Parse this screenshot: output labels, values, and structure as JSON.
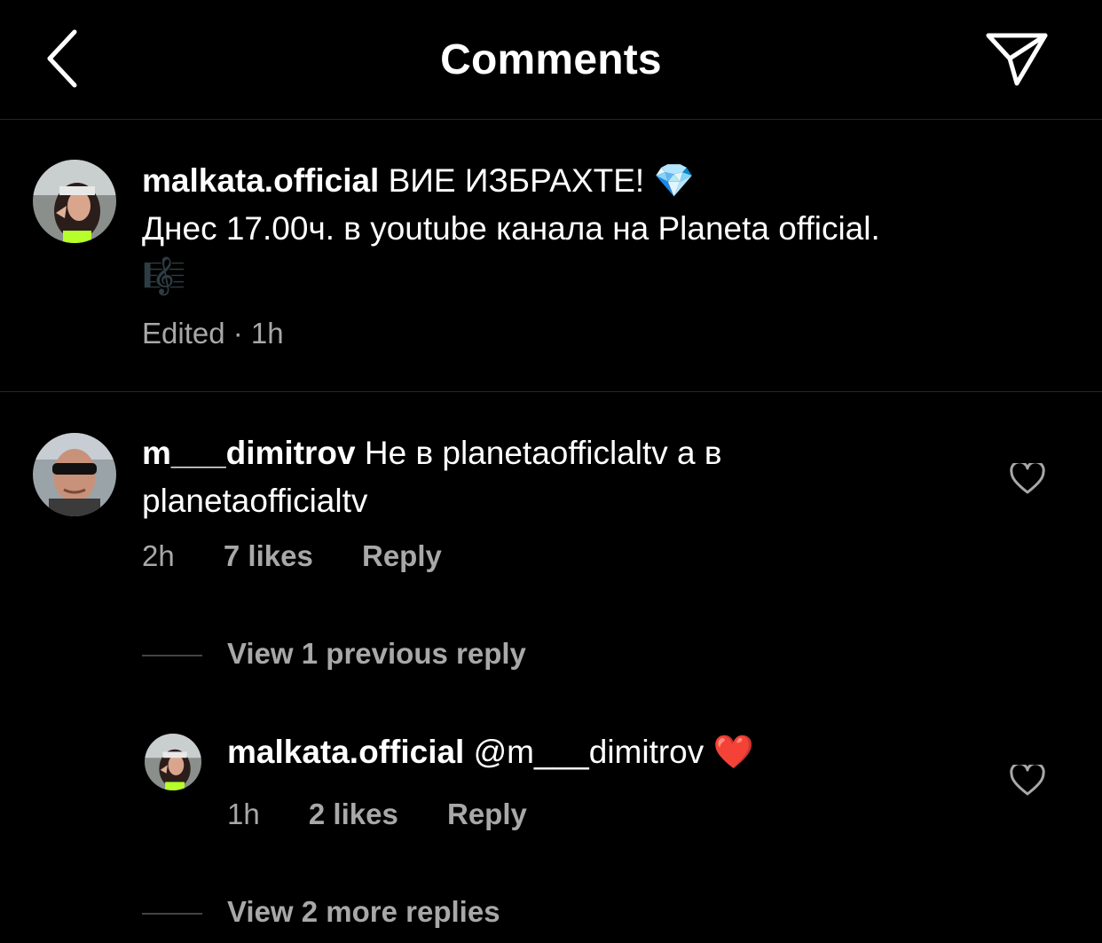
{
  "header": {
    "title": "Comments",
    "back_icon": "chevron-left-icon",
    "share_icon": "paper-plane-icon"
  },
  "caption": {
    "username": "malkata.official",
    "text_line1": "ВИЕ ИЗБРАХТЕ! 💎",
    "text_line2": "Днес  17.00ч. в youtube канала на  Planeta official.",
    "text_line3": "🎼",
    "meta": "Edited · 1h"
  },
  "comments": [
    {
      "username": "m___dimitrov",
      "text": "Не в planetaofficlaltv а в planetaofficialtv",
      "time": "2h",
      "likes": "7 likes",
      "reply_label": "Reply"
    }
  ],
  "view_previous": "View 1 previous reply",
  "reply": {
    "username": "malkata.official",
    "text": "@m___dimitrov ❤️",
    "time": "1h",
    "likes": "2 likes",
    "reply_label": "Reply"
  },
  "view_more": "View 2 more replies",
  "colors": {
    "background": "#000000",
    "text": "#ffffff",
    "secondary": "#a8a8a8",
    "divider": "#262626"
  }
}
